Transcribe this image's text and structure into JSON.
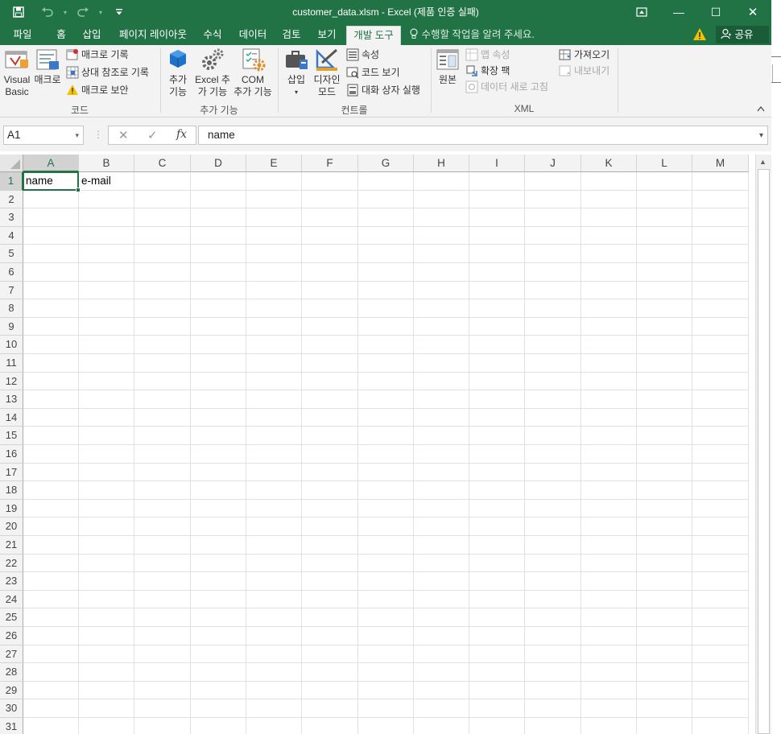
{
  "window": {
    "title": "customer_data.xlsm - Excel (제품 인증 실패)",
    "minimize_glyph": "—",
    "maximize_glyph": "☐",
    "close_glyph": "✕",
    "ribbon_display_glyph": "⊡"
  },
  "qat": {
    "save_icon": "save-icon",
    "undo_icon": "undo-icon",
    "redo_icon": "redo-icon",
    "customize_icon": "customize-qat-icon"
  },
  "tabs": [
    {
      "label": "파일"
    },
    {
      "label": "홈"
    },
    {
      "label": "삽입"
    },
    {
      "label": "페이지 레이아웃"
    },
    {
      "label": "수식"
    },
    {
      "label": "데이터"
    },
    {
      "label": "검토"
    },
    {
      "label": "보기"
    },
    {
      "label": "개발 도구",
      "active": true
    }
  ],
  "tell_me": "수행할 작업을 알려 주세요.",
  "share": "공유",
  "ribbon": {
    "code": {
      "label": "코드",
      "visual_basic": [
        "Visual",
        "Basic"
      ],
      "macros": "매크로",
      "record_macro": "매크로 기록",
      "relative_refs": "상대 참조로 기록",
      "macro_security": "매크로 보안"
    },
    "addins": {
      "label": "추가 기능",
      "addins_btn": [
        "추가",
        "기능"
      ],
      "excel_addins": [
        "Excel 추",
        "가 기능"
      ],
      "com_addins": [
        "COM",
        "추가 기능"
      ]
    },
    "controls": {
      "label": "컨트롤",
      "insert": "삽입",
      "design_mode": [
        "디자인",
        "모드"
      ],
      "properties": "속성",
      "view_code": "코드 보기",
      "run_dialog": "대화 상자 실행"
    },
    "xml": {
      "label": "XML",
      "source": "원본",
      "map_properties": "맵 속성",
      "expansion_packs": "확장 팩",
      "refresh_data": "데이터 새로 고침",
      "import": "가져오기",
      "export": "내보내기"
    }
  },
  "formula_bar": {
    "name_box": "A1",
    "cancel_glyph": "✕",
    "enter_glyph": "✓",
    "fx_glyph": "fx",
    "content": "name"
  },
  "sheet": {
    "columns": [
      "A",
      "B",
      "C",
      "D",
      "E",
      "F",
      "G",
      "H",
      "I",
      "J",
      "K",
      "L",
      "M"
    ],
    "rows": [
      "1",
      "2",
      "3",
      "4",
      "5",
      "6",
      "7",
      "8",
      "9",
      "10",
      "11",
      "12",
      "13",
      "14",
      "15",
      "16",
      "17",
      "18",
      "19",
      "20",
      "21",
      "22",
      "23",
      "24",
      "25",
      "26",
      "27",
      "28",
      "29",
      "30",
      "31"
    ],
    "cells": {
      "A1": "name",
      "B1": "e-mail"
    },
    "selected": "A1"
  },
  "colors": {
    "accent": "#217346",
    "ribbon_bg": "#f3f3f3",
    "grid_line": "#e1e1e1"
  }
}
